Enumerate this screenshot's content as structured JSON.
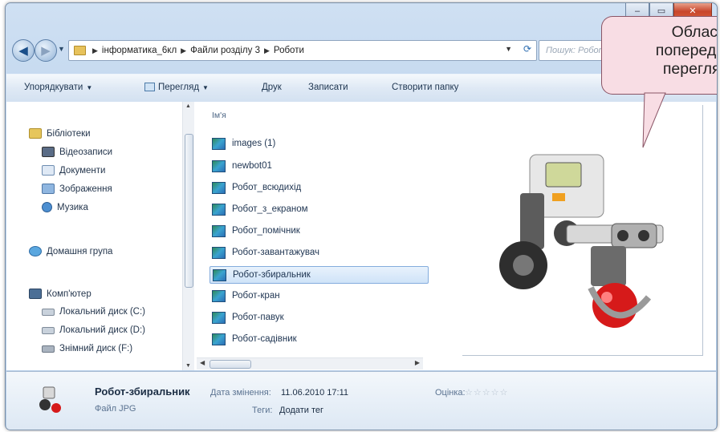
{
  "window": {
    "minimize": "‒",
    "maximize": "▭",
    "close": "✕"
  },
  "address": {
    "crumbs": [
      "інформатика_6кл",
      "Файли розділу 3",
      "Роботи"
    ],
    "search_placeholder": "Пошук: Роботи"
  },
  "toolbar": {
    "organize": "Упорядкувати",
    "view": "Перегляд",
    "print": "Друк",
    "burn": "Записати",
    "new_folder": "Створити папку"
  },
  "nav": {
    "libraries": "Бібліотеки",
    "videos": "Відеозаписи",
    "documents": "Документи",
    "pictures": "Зображення",
    "music": "Музика",
    "homegroup": "Домашня група",
    "computer": "Комп'ютер",
    "disk_c": "Локальний диск (C:)",
    "disk_d": "Локальний диск (D:)",
    "disk_f": "Знімний диск (F:)"
  },
  "files": {
    "column_name": "Ім'я",
    "items": [
      "images (1)",
      "newbot01",
      "Робот_всюдихід",
      "Робот_з_екраном",
      "Робот_помічник",
      "Робот-завантажувач",
      "Робот-збиральник",
      "Робот-кран",
      "Робот-павук",
      "Робот-садівник"
    ],
    "selected_index": 6
  },
  "callout": {
    "line1": "Област",
    "line2": "попередн",
    "line3": "перегля,"
  },
  "details": {
    "name": "Робот-збиральник",
    "type": "Файл JPG",
    "modified_label": "Дата змінення:",
    "modified_value": "11.06.2010 17:11",
    "tags_label": "Теги:",
    "tags_value": "Додати тег",
    "rating_label": "Оцінка:",
    "rating_stars": "☆☆☆☆☆"
  },
  "colors": {
    "accent": "#c8452a",
    "selection": "#cfe3f8",
    "callout": "#f8dde4"
  }
}
